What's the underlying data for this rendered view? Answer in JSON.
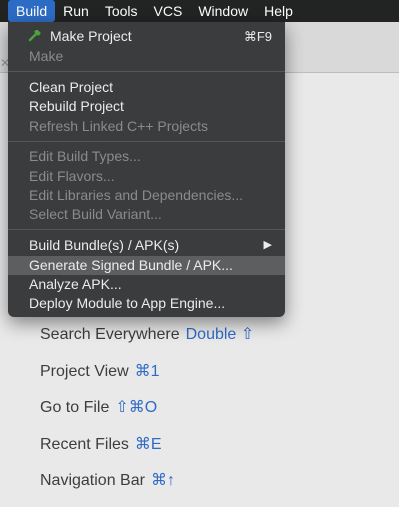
{
  "menubar": {
    "items": [
      "Build",
      "Run",
      "Tools",
      "VCS",
      "Window",
      "Help"
    ],
    "active": "Build"
  },
  "build_menu": {
    "make_project": {
      "label": "Make Project",
      "shortcut": "⌘F9"
    },
    "make": "Make",
    "clean_project": "Clean Project",
    "rebuild_project": "Rebuild Project",
    "refresh_linked_cpp": "Refresh Linked C++ Projects",
    "edit_build_types": "Edit Build Types...",
    "edit_flavors": "Edit Flavors...",
    "edit_libraries": "Edit Libraries and Dependencies...",
    "select_build_variant": "Select Build Variant...",
    "build_bundles": "Build Bundle(s) / APK(s)",
    "generate_signed": "Generate Signed Bundle / APK...",
    "analyze_apk": "Analyze APK...",
    "deploy_module": "Deploy Module to App Engine..."
  },
  "welcome_tips": [
    {
      "label": "Search Everywhere",
      "shortcut": "Double ⇧"
    },
    {
      "label": "Project View",
      "shortcut": "⌘1"
    },
    {
      "label": "Go to File",
      "shortcut": "⇧⌘O"
    },
    {
      "label": "Recent Files",
      "shortcut": "⌘E"
    },
    {
      "label": "Navigation Bar",
      "shortcut": "⌘↑"
    }
  ],
  "colors": {
    "menubar_bg": "#222323",
    "active_menu": "#2d6cc5",
    "dropdown_bg": "#3b3c3d",
    "selected_item": "#5c5e60",
    "shortcut_blue": "#2f6bc6"
  }
}
